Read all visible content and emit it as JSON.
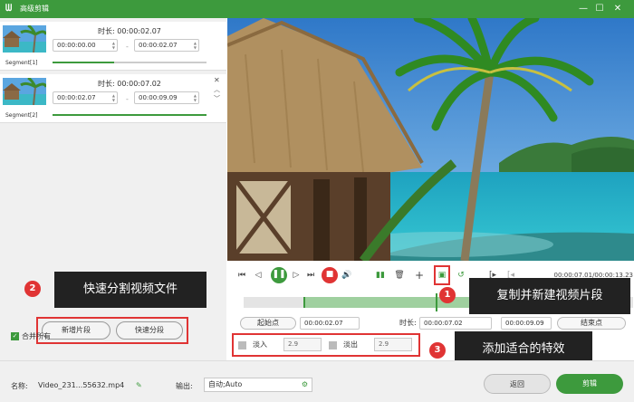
{
  "window": {
    "title": "高级剪辑",
    "minimize": "—",
    "maximize": "☐",
    "close": "✕"
  },
  "segments": [
    {
      "label": "Segment[1]",
      "duration": "时长:  00:00:02.07",
      "start": "00:00:00.00",
      "end": "00:00:02.07",
      "progress": 0.4
    },
    {
      "label": "Segment[2]",
      "duration": "时长:  00:00:07.02",
      "start": "00:00:02.07",
      "end": "00:00:09.09",
      "progress": 1.0
    }
  ],
  "annotations": [
    {
      "num": "1",
      "text": "复制并新建视频片段"
    },
    {
      "num": "2",
      "text": "快速分割视频文件"
    },
    {
      "num": "3",
      "text": "添加适合的特效"
    }
  ],
  "buttons": {
    "add_segment": "新增片段",
    "quick_split": "快速分段",
    "back": "返回",
    "cut": "剪辑"
  },
  "merge_all": "合并所有",
  "time_display": "00:00:07.01/00:00:13.23",
  "range": {
    "start_btn": "起始点",
    "start_val": "00:00:02.07",
    "duration_label": "时长:",
    "duration_val": "00:00:07.02",
    "end_val": "00:00:09.09",
    "end_btn": "结束点"
  },
  "effects": {
    "fade_in": "淡入",
    "fade_in_val": "2.9",
    "fade_out": "淡出",
    "fade_out_val": "2.9"
  },
  "footer": {
    "name_label": "名称:",
    "filename": "Video_231...55632.mp4",
    "output_label": "输出:",
    "output_value": "自动;Auto"
  },
  "colors": {
    "accent": "#3d9a3d",
    "annotation_red": "#e03434"
  }
}
